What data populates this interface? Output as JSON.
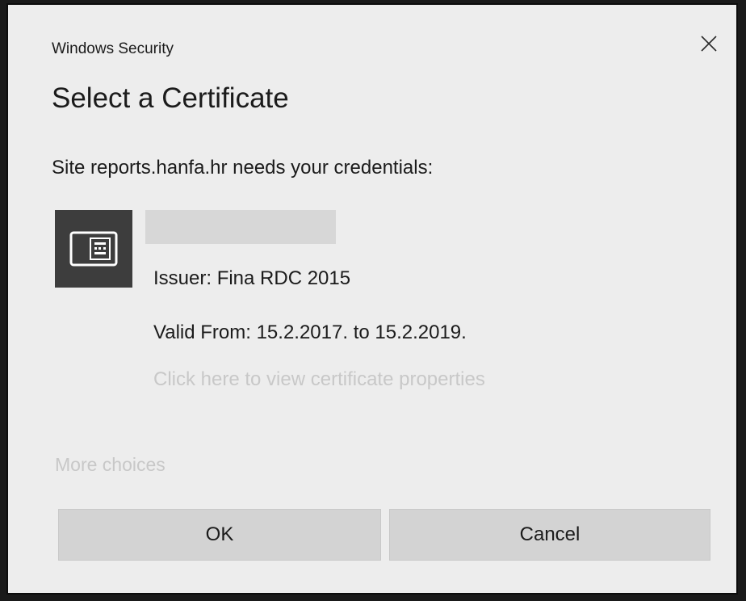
{
  "window": {
    "app_title": "Windows Security",
    "close_icon": "close-icon"
  },
  "dialog": {
    "heading": "Select a Certificate",
    "prompt": "Site reports.hanfa.hr needs your credentials:"
  },
  "certificate": {
    "icon": "certificate-icon",
    "issuer": "Issuer: Fina RDC 2015",
    "valid": "Valid From: 15.2.2017. to 15.2.2019.",
    "properties_link": "Click here to view certificate properties"
  },
  "more_choices": "More choices",
  "buttons": {
    "ok": "OK",
    "cancel": "Cancel"
  },
  "colors": {
    "dialog_bg": "#ededed",
    "tile_bg": "#3d3d3d",
    "button_bg": "#d3d3d3",
    "muted_text": "#c8c8c8"
  }
}
